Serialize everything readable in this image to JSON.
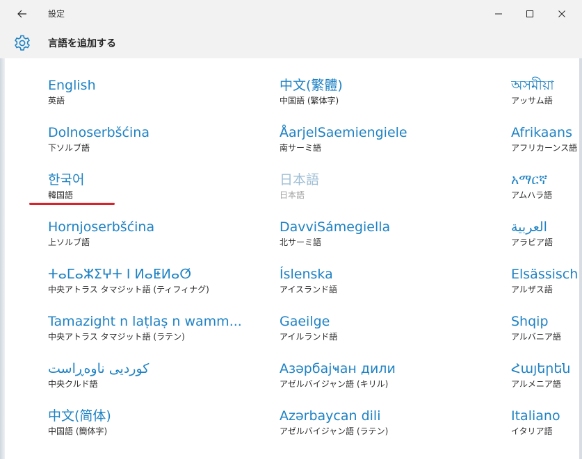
{
  "titlebar": {
    "title": "設定"
  },
  "header": {
    "page_title": "言語を追加する"
  },
  "languages": [
    {
      "native": "English",
      "sub": "英語"
    },
    {
      "native": "Dolnoserbšćina",
      "sub": "下ソルブ語"
    },
    {
      "native": "한국어",
      "sub": "韓国語"
    },
    {
      "native": "Hornjoserbšćina",
      "sub": "上ソルブ語"
    },
    {
      "native": "ⵜⴰⵎⴰⵣⵉⵖⵜ ⵏ ⵍⴰⵟⵍⴰⵚ",
      "sub": "中央アトラス タマジット語 (ティフィナグ)"
    },
    {
      "native": "Tamazight n laṭlaṣ n wamm...",
      "sub": "中央アトラス タマジット語 (ラテン)"
    },
    {
      "native": "کوردیی ناوەڕاست",
      "sub": "中央クルド語"
    },
    {
      "native": "中文(简体)",
      "sub": "中国語 (簡体字)"
    },
    {
      "native": "中文(繁體)",
      "sub": "中国語 (繁体字)"
    },
    {
      "native": "ÅarjelSaemiengiele",
      "sub": "南サーミ語"
    },
    {
      "native": "日本語",
      "sub": "日本語",
      "disabled": true
    },
    {
      "native": "DavviSámegiella",
      "sub": "北サーミ語"
    },
    {
      "native": "Íslenska",
      "sub": "アイスランド語"
    },
    {
      "native": "Gaeilge",
      "sub": "アイルランド語"
    },
    {
      "native": "Азәрбајҹан дили",
      "sub": "アゼルバイジャン語 (キリル)"
    },
    {
      "native": "Azərbaycan dili",
      "sub": "アゼルバイジャン語 (ラテン)"
    },
    {
      "native": "অসমীয়া",
      "sub": "アッサム語"
    },
    {
      "native": "Afrikaans",
      "sub": "アフリカーンス語"
    },
    {
      "native": "አማርኛ",
      "sub": "アムハラ語"
    },
    {
      "native": "العربية",
      "sub": "アラビア語"
    },
    {
      "native": "Elsässisch",
      "sub": "アルザス語"
    },
    {
      "native": "Shqip",
      "sub": "アルバニア語"
    },
    {
      "native": "Հայերեն",
      "sub": "アルメニア語"
    },
    {
      "native": "Italiano",
      "sub": "イタリア語"
    }
  ]
}
